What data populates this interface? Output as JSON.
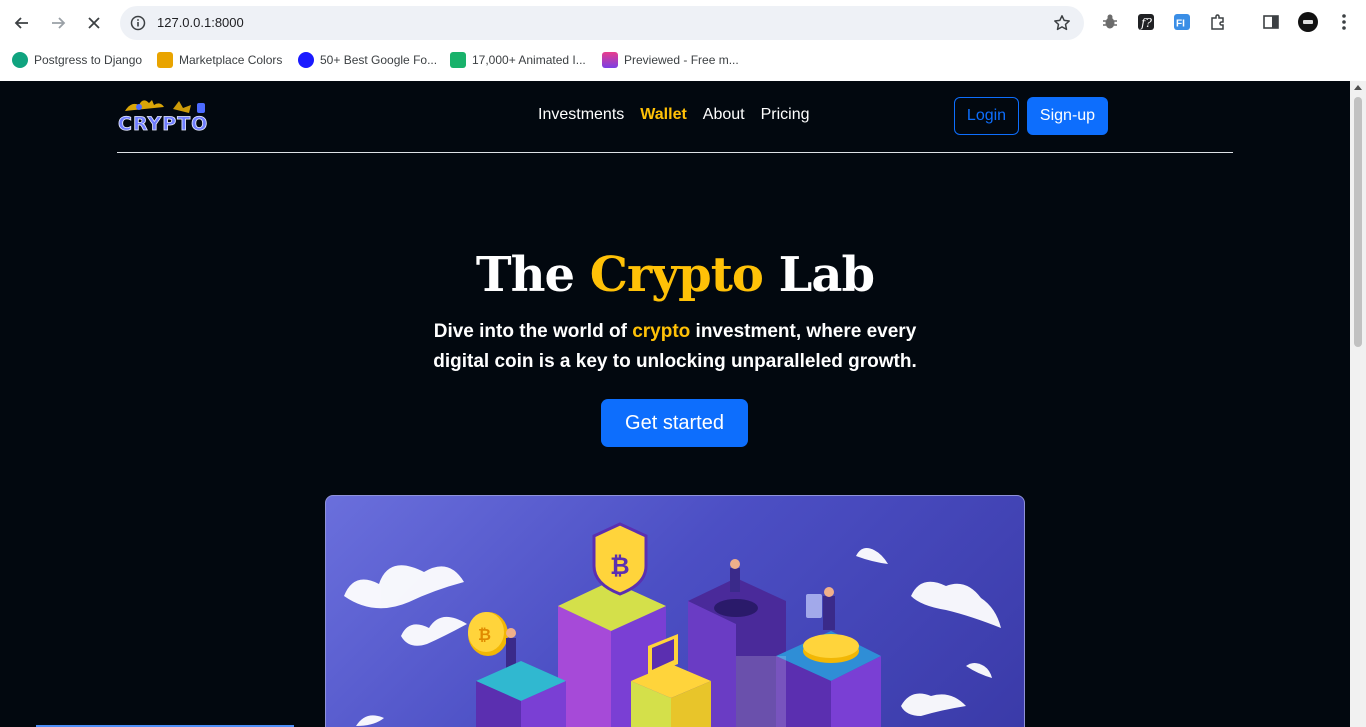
{
  "browser": {
    "url": "127.0.0.1:8000",
    "bookmarks": [
      {
        "label": "Postgress to Django",
        "icon": "chatgpt-icon",
        "color": "#10a37f"
      },
      {
        "label": "Marketplace Colors",
        "icon": "marketplace-icon",
        "color": "#e9a400"
      },
      {
        "label": "50+ Best Google Fo...",
        "icon": "google-fonts-icon",
        "color": "#1a1aff"
      },
      {
        "label": "17,000+ Animated I...",
        "icon": "animated-icons-icon",
        "color": "#19b26b"
      },
      {
        "label": "Previewed - Free m...",
        "icon": "previewed-icon",
        "color": "#7b3fe4"
      }
    ]
  },
  "navbar": {
    "logo_text": "CRYPTO",
    "links": [
      "Investments",
      "Wallet",
      "About",
      "Pricing"
    ],
    "active_link": "Wallet",
    "login_label": "Login",
    "signup_label": "Sign-up"
  },
  "hero": {
    "title_part1": "The ",
    "title_accent": "Crypto",
    "title_part2": " Lab",
    "sub_part1": "Dive into the world of ",
    "sub_accent": "crypto",
    "sub_part2": " investment, where every digital coin is a key to unlocking unparalleled growth.",
    "cta_label": "Get started"
  },
  "colors": {
    "accent": "#ffc107",
    "primary": "#0d6efd",
    "background": "#02080f"
  }
}
